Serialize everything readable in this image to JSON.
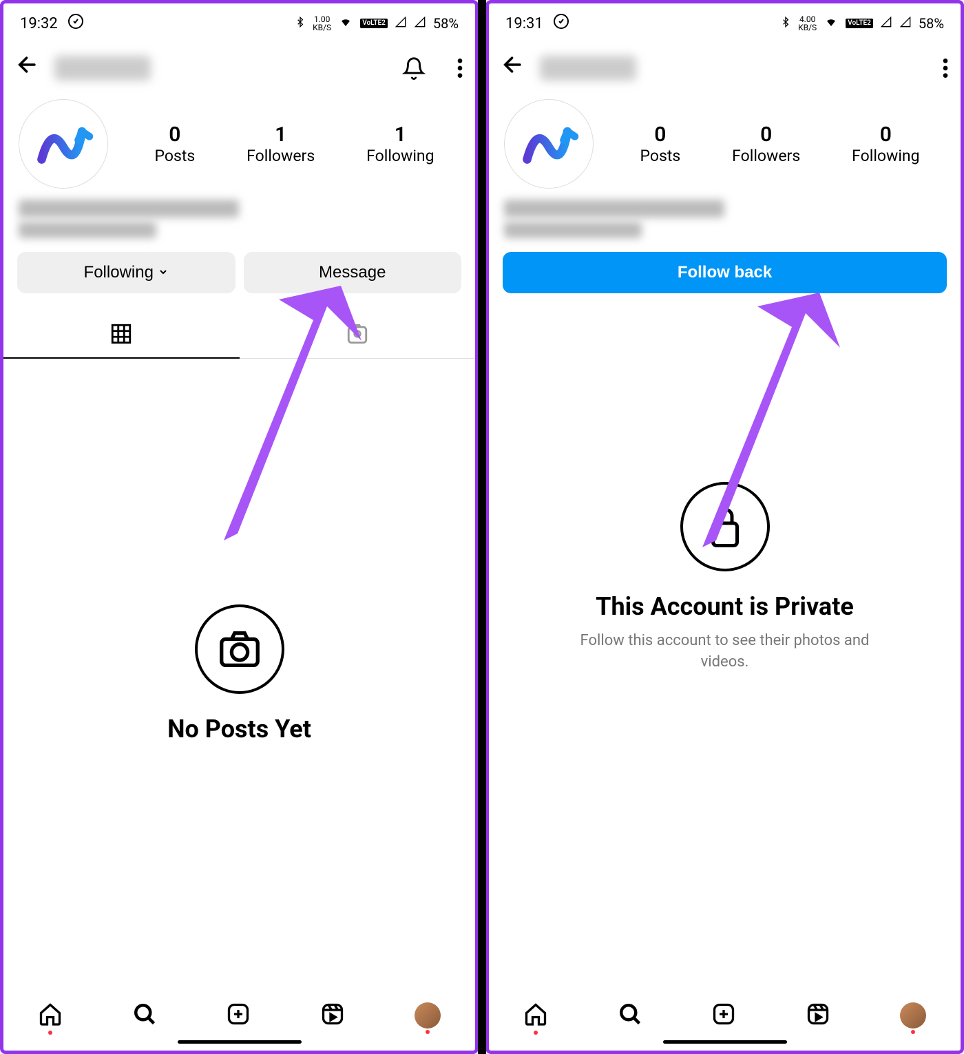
{
  "left": {
    "status": {
      "time": "19:32",
      "kbs_num": "1.00",
      "kbs_label": "KB/S",
      "lte": "VoLTE2",
      "battery": "58%"
    },
    "stats": {
      "posts": {
        "count": "0",
        "label": "Posts"
      },
      "followers": {
        "count": "1",
        "label": "Followers"
      },
      "following": {
        "count": "1",
        "label": "Following"
      }
    },
    "buttons": {
      "following": "Following",
      "message": "Message"
    },
    "empty": {
      "title": "No Posts Yet"
    }
  },
  "right": {
    "status": {
      "time": "19:31",
      "kbs_num": "4.00",
      "kbs_label": "KB/S",
      "lte": "VoLTE2",
      "battery": "58%"
    },
    "stats": {
      "posts": {
        "count": "0",
        "label": "Posts"
      },
      "followers": {
        "count": "0",
        "label": "Followers"
      },
      "following": {
        "count": "0",
        "label": "Following"
      }
    },
    "buttons": {
      "follow_back": "Follow back"
    },
    "private": {
      "title": "This Account is Private",
      "subtitle": "Follow this account to see their photos and videos."
    }
  }
}
